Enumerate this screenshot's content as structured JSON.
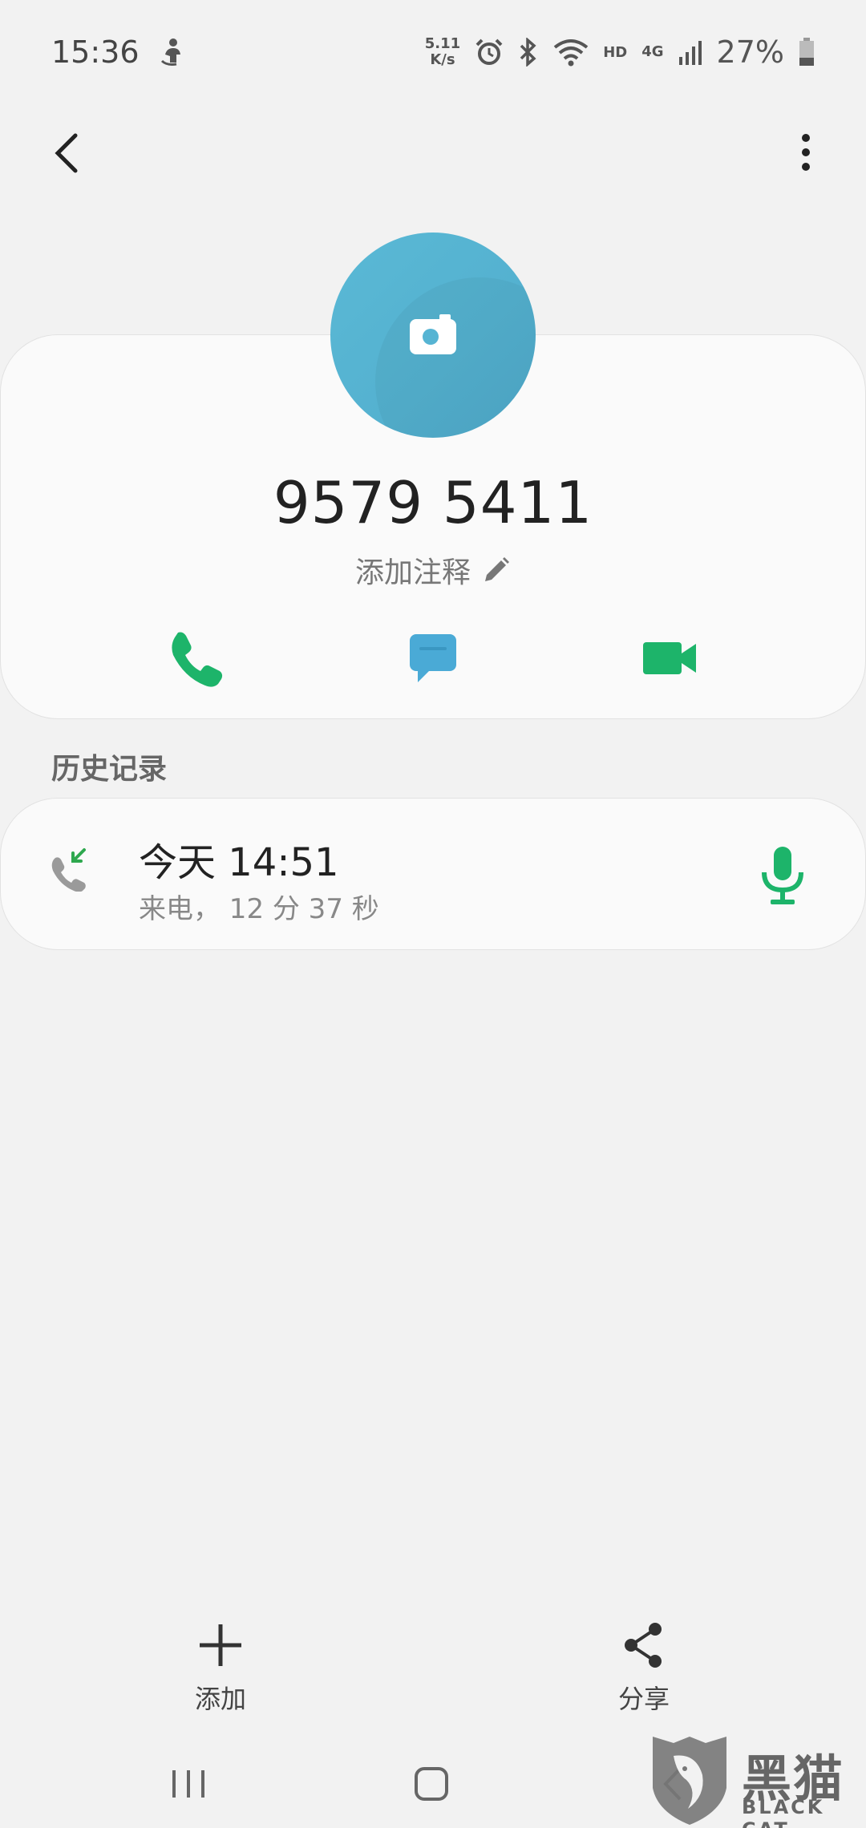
{
  "status_bar": {
    "time": "15:36",
    "net_speed_value": "5.11",
    "net_speed_unit": "K/s",
    "hd": "HD",
    "network": "4G",
    "battery": "27%"
  },
  "contact": {
    "number": "9579 5411",
    "note_label": "添加注释"
  },
  "history": {
    "section_title": "历史记录",
    "entries": [
      {
        "time": "今天 14:51",
        "detail": "来电， 12 分 37 秒"
      }
    ]
  },
  "bottom_actions": {
    "add_label": "添加",
    "share_label": "分享"
  },
  "watermark": {
    "text": "黑猫",
    "sub": "BLACK CAT"
  },
  "colors": {
    "green": "#1db46a",
    "avatar_blue": "#56b4d3",
    "message_blue": "#4aaad6"
  }
}
